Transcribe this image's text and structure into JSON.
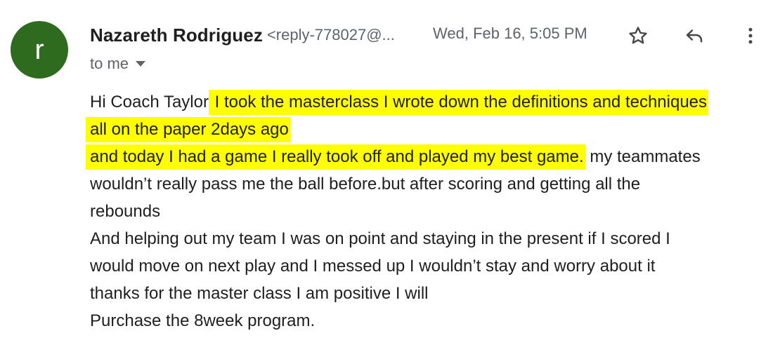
{
  "colors": {
    "avatar_bg": "#2e6b1f",
    "highlight": "#ffff00",
    "secondary_text": "#5f6368"
  },
  "avatar": {
    "initial": "r"
  },
  "sender": {
    "name": "Nazareth Rodriguez",
    "email": "<reply-778027@..."
  },
  "timestamp": "Wed, Feb 16, 5:05 PM",
  "recipient": {
    "label": "to me"
  },
  "actions": {
    "star_icon": "star-icon",
    "reply_icon": "reply-icon",
    "more_icon": "more-vertical-icon"
  },
  "body": {
    "line1_plain": "Hi Coach Taylor",
    "line1_highlight": " I took the masterclass I wrote down the definitions and techniques",
    "line2_highlight": "all on the paper 2days ago ",
    "line3_highlight": "and today I had a game I really took off and played my best game.",
    "line3_plain": " my teammates",
    "line4": "wouldn’t really pass me the ball before.but after scoring and getting all the",
    "line5": "rebounds",
    "line6": "And helping out my team I was on point and staying in the present if I scored I",
    "line7": "would move on next play and I messed up I wouldn’t stay and worry about it",
    "line8": "thanks for the master class I am positive I will",
    "line9": "Purchase the 8week program."
  }
}
